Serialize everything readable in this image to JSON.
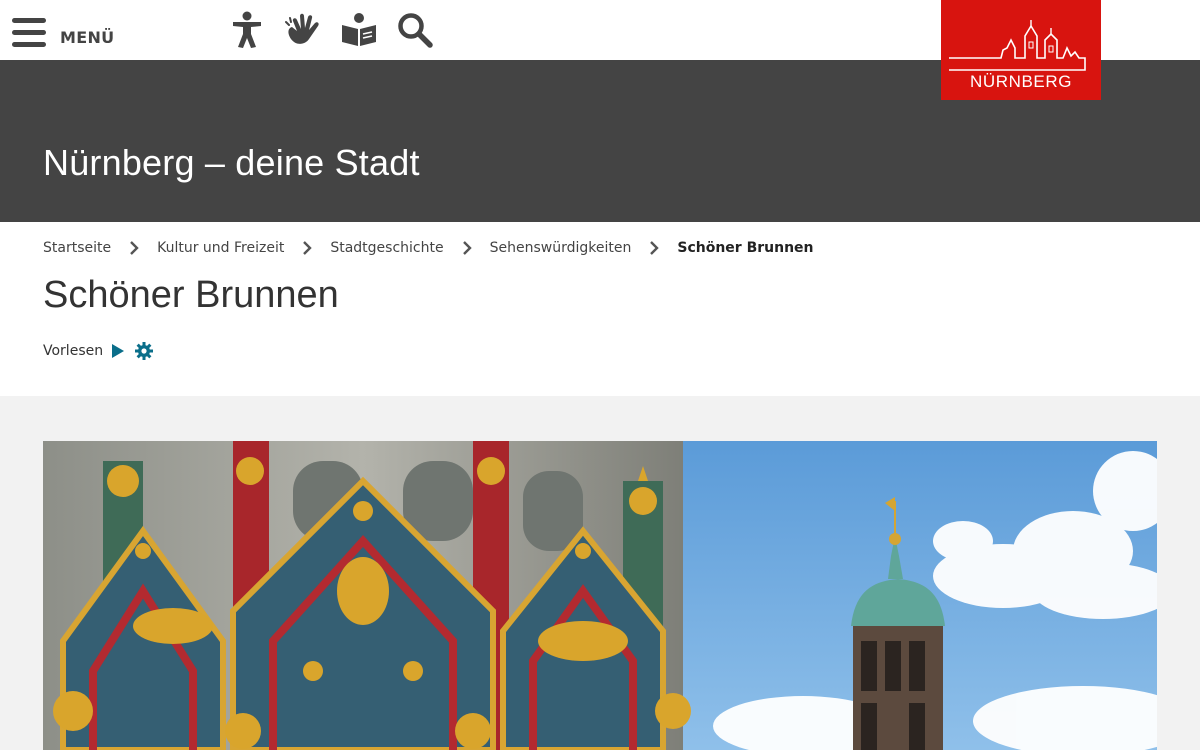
{
  "header": {
    "menu_label": "MENÜ",
    "tools": [
      {
        "name": "accessibility-icon"
      },
      {
        "name": "sign-language-icon"
      },
      {
        "name": "easy-language-icon"
      },
      {
        "name": "search-icon"
      }
    ],
    "logo_text": "NÜRNBERG"
  },
  "site": {
    "title": "Nürnberg – deine Stadt"
  },
  "breadcrumb": {
    "items": [
      "Startseite",
      "Kultur und Freizeit",
      "Stadtgeschichte",
      "Sehenswürdigkeiten",
      "Schöner Brunnen"
    ]
  },
  "page": {
    "title": "Schöner Brunnen"
  },
  "readspeaker": {
    "label": "Vorlesen"
  },
  "colors": {
    "brand_red": "#d8140f",
    "header_dark": "#444444",
    "accent_teal": "#0a6e8a",
    "content_bg": "#f2f2f2"
  }
}
